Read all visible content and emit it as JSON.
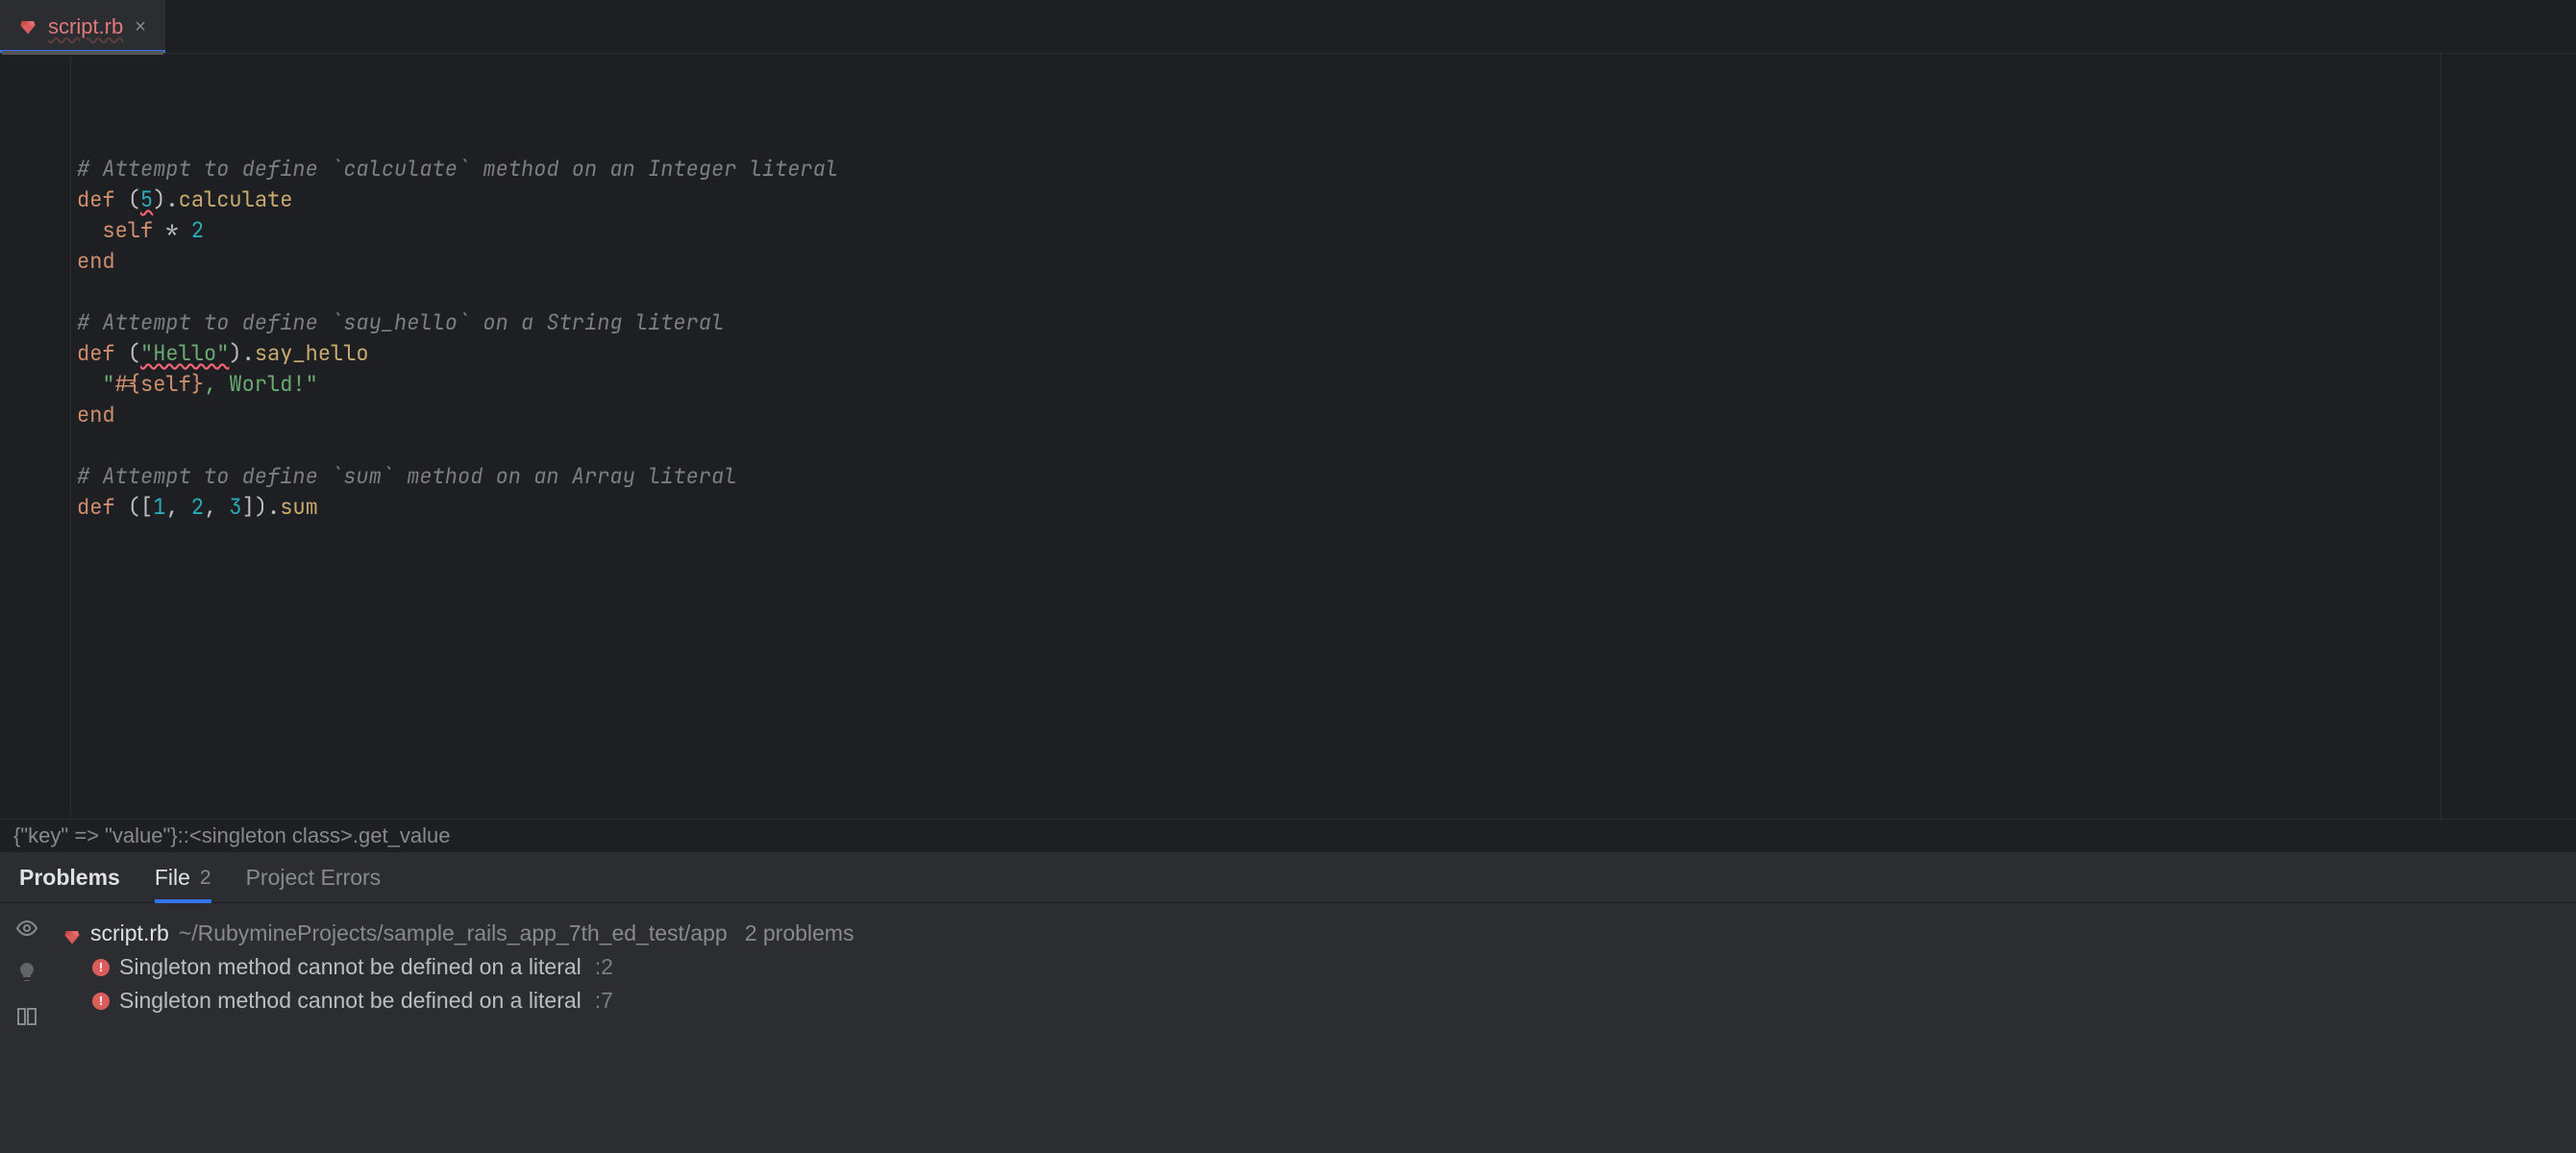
{
  "tab": {
    "filename": "script.rb"
  },
  "code": {
    "lines": [
      {
        "type": "comment",
        "text": "# Attempt to define `calculate` method on an Integer literal"
      },
      {
        "type": "def_int",
        "kw": "def",
        "open": " (",
        "lit": "5",
        "close": ").",
        "method": "calculate"
      },
      {
        "type": "body1",
        "indent": "  ",
        "self": "self",
        "op": " * ",
        "num": "2"
      },
      {
        "type": "end",
        "kw": "end"
      },
      {
        "type": "blank"
      },
      {
        "type": "comment",
        "text": "# Attempt to define `say_hello` on a String literal"
      },
      {
        "type": "def_str",
        "kw": "def",
        "open": " (",
        "lit": "\"Hello\"",
        "close": ").",
        "method": "say_hello"
      },
      {
        "type": "body2",
        "indent": "  ",
        "q1": "\"",
        "interp_open": "#{",
        "self": "self",
        "interp_close": "}",
        "rest": ", World!",
        "q2": "\""
      },
      {
        "type": "end",
        "kw": "end"
      },
      {
        "type": "blank"
      },
      {
        "type": "comment",
        "text": "# Attempt to define `sum` method on an Array literal"
      },
      {
        "type": "def_arr",
        "kw": "def",
        "open": " ([",
        "a": "1",
        "s1": ", ",
        "b": "2",
        "s2": ", ",
        "c": "3",
        "close": "]).",
        "method": "sum"
      }
    ]
  },
  "breadcrumb": {
    "text": "{\"key\" => \"value\"}::<singleton class>.get_value"
  },
  "problems": {
    "tabs": {
      "main": "Problems",
      "file": "File",
      "file_count": "2",
      "project": "Project Errors"
    },
    "file": {
      "name": "script.rb",
      "path": "~/RubymineProjects/sample_rails_app_7th_ed_test/app",
      "summary": "2 problems"
    },
    "items": [
      {
        "msg": "Singleton method cannot be defined on a literal",
        "loc": ":2"
      },
      {
        "msg": "Singleton method cannot be defined on a literal",
        "loc": ":7"
      }
    ]
  }
}
